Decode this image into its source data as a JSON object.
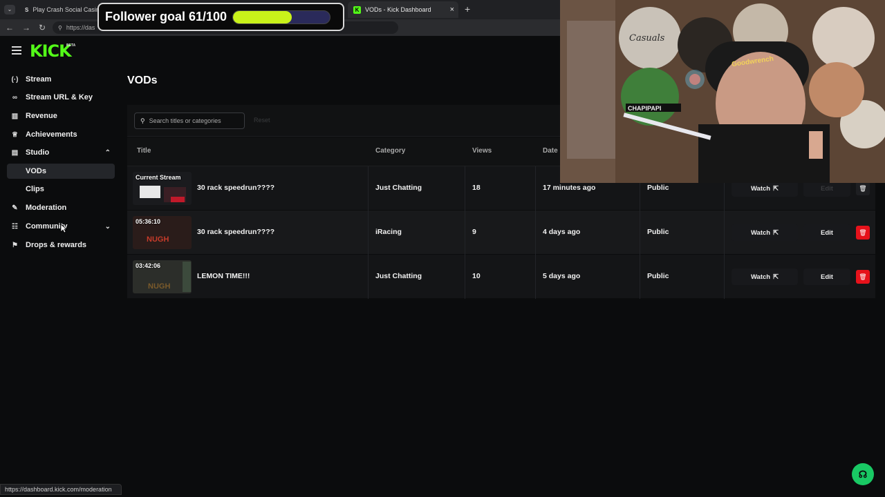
{
  "browser": {
    "tabs": [
      {
        "title": "Play Crash Social Casino G",
        "favicon": "S"
      },
      {
        "title": "VODs - Kick Dashboard",
        "favicon": "K"
      }
    ],
    "new_tab": "+",
    "close": "×",
    "url": "https://das"
  },
  "overlay": {
    "goal_text": "Follower goal 61/100",
    "goal_current": 61,
    "goal_target": 100,
    "bar_color": "#c9f21a"
  },
  "app": {
    "logo": "KICK",
    "logo_badge": "BETA",
    "brand_color": "#53fc18"
  },
  "sidebar": {
    "items": [
      {
        "label": "Stream",
        "icon": "signal-icon"
      },
      {
        "label": "Stream URL & Key",
        "icon": "link-icon"
      },
      {
        "label": "Revenue",
        "icon": "chart-icon"
      },
      {
        "label": "Achievements",
        "icon": "trophy-icon"
      },
      {
        "label": "Studio",
        "icon": "studio-icon"
      },
      {
        "label": "VODs",
        "icon": ""
      },
      {
        "label": "Clips",
        "icon": ""
      },
      {
        "label": "Moderation",
        "icon": "wrench-icon"
      },
      {
        "label": "Community",
        "icon": "users-icon"
      },
      {
        "label": "Drops & rewards",
        "icon": "gift-icon"
      }
    ]
  },
  "main": {
    "title": "VODs",
    "search_placeholder": "Search titles or categories",
    "reset_label": "Reset",
    "columns": [
      "Title",
      "Category",
      "Views",
      "Date"
    ],
    "rows": [
      {
        "badge": "Current Stream",
        "title": "30 rack speedrun????",
        "category": "Just Chatting",
        "views": "18",
        "date": "17 minutes ago",
        "visibility": "Public",
        "watch": "Watch",
        "edit": "Edit"
      },
      {
        "badge": "05:36:10",
        "title": "30 rack speedrun????",
        "category": "iRacing",
        "views": "9",
        "date": "4 days ago",
        "visibility": "Public",
        "watch": "Watch",
        "edit": "Edit"
      },
      {
        "badge": "03:42:06",
        "title": "LEMON TIME!!!",
        "category": "Just Chatting",
        "views": "10",
        "date": "5 days ago",
        "visibility": "Public",
        "watch": "Watch",
        "edit": "Edit"
      }
    ]
  },
  "statusbar": {
    "text": "https://dashboard.kick.com/moderation"
  },
  "webcam": {
    "cap_text": "Goodwrench",
    "sign_text": "CHAPIPAPI",
    "plate_text": "Casuals"
  }
}
